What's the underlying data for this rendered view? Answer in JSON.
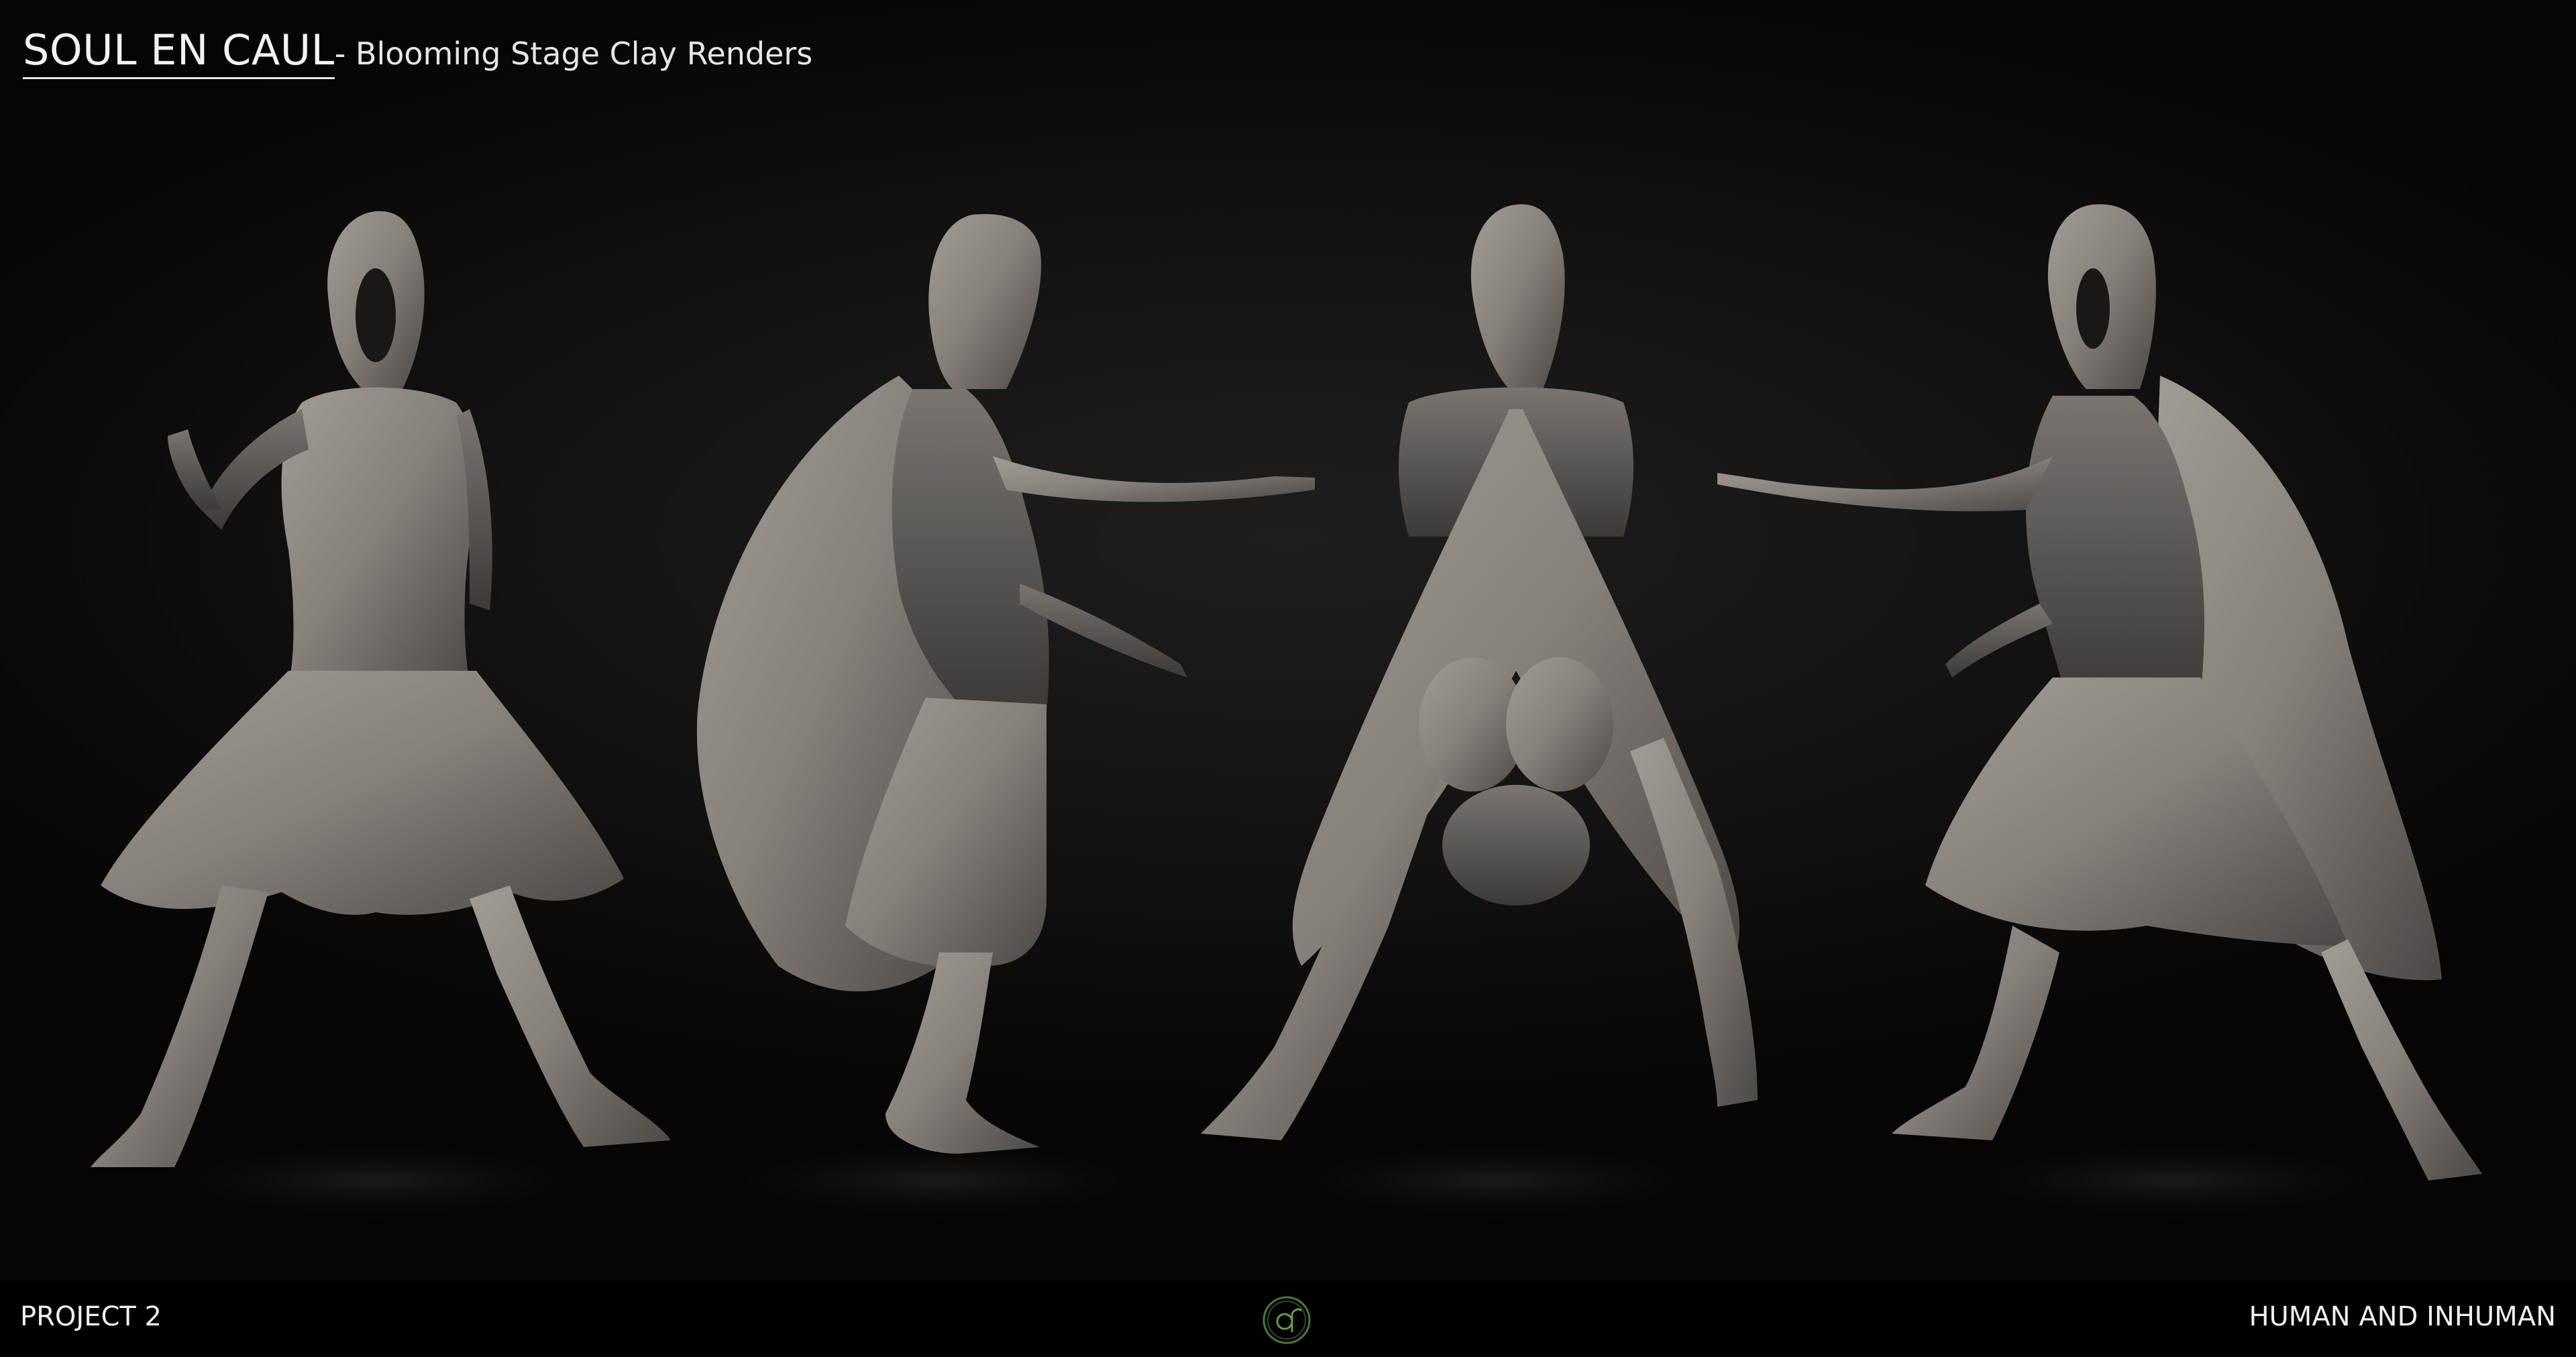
{
  "header": {
    "title": "SOUL EN CAUL",
    "subtitle": "- Blooming Stage Clay Renders"
  },
  "footer": {
    "left_text": "PROJECT 2",
    "right_text": "HUMAN AND INHUMAN",
    "logo_icon": "circle-q-logo-icon"
  },
  "colors": {
    "background": "#0a0a0a",
    "clay": "#8c8782",
    "text": "#f0f0f0",
    "logo_accent": "#4a7a34"
  },
  "figures": [
    {
      "view": "front-view"
    },
    {
      "view": "side-view-right"
    },
    {
      "view": "back-view"
    },
    {
      "view": "three-quarter-view-left"
    }
  ]
}
